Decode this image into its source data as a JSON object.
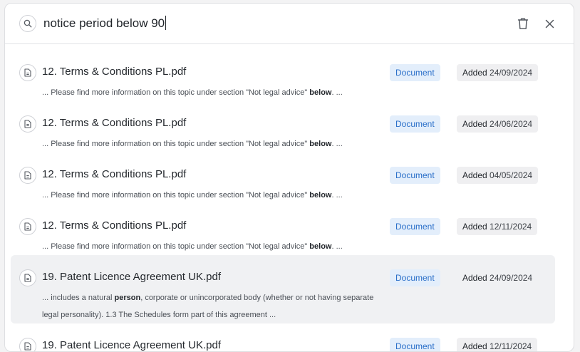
{
  "search": {
    "query": "notice period below 90",
    "icon": "search-icon",
    "clear_icon": "trash-icon",
    "close_icon": "close-icon"
  },
  "colors": {
    "badge_type_bg": "#e3eefb",
    "badge_type_text": "#2a6fc9",
    "badge_date_bg": "#efeff1",
    "highlight_bg": "#f0f1f3"
  },
  "results": [
    {
      "title": "12. Terms & Conditions PL.pdf",
      "snippet_parts": [
        "... Please find more information on this topic under section \"Not legal advice\" ",
        "below",
        ". ..."
      ],
      "type": "Document",
      "added_label": "Added",
      "added_date": "24/09/2024"
    },
    {
      "title": "12. Terms & Conditions PL.pdf",
      "snippet_parts": [
        "... Please find more information on this topic under section \"Not legal advice\" ",
        "below",
        ". ..."
      ],
      "type": "Document",
      "added_label": "Added",
      "added_date": "24/06/2024"
    },
    {
      "title": "12. Terms & Conditions PL.pdf",
      "snippet_parts": [
        "... Please find more information on this topic under section \"Not legal advice\" ",
        "below",
        ". ..."
      ],
      "type": "Document",
      "added_label": "Added",
      "added_date": "04/05/2024"
    },
    {
      "title": "12. Terms & Conditions PL.pdf",
      "snippet_parts": [
        "... Please find more information on this topic under section \"Not legal advice\" ",
        "below",
        ". ..."
      ],
      "type": "Document",
      "added_label": "Added",
      "added_date": "12/11/2024"
    },
    {
      "title": "19. Patent Licence Agreement UK.pdf",
      "snippet_parts": [
        "... includes a natural ",
        "person",
        ", corporate or unincorporated body (whether or not having separate legal personality). 1.3 The Schedules form part of this agreement ..."
      ],
      "type": "Document",
      "added_label": "Added",
      "added_date": "24/09/2024"
    },
    {
      "title": "19. Patent Licence Agreement UK.pdf",
      "snippet_parts": [
        "",
        "",
        ""
      ],
      "type": "Document",
      "added_label": "Added",
      "added_date": "12/11/2024"
    }
  ]
}
